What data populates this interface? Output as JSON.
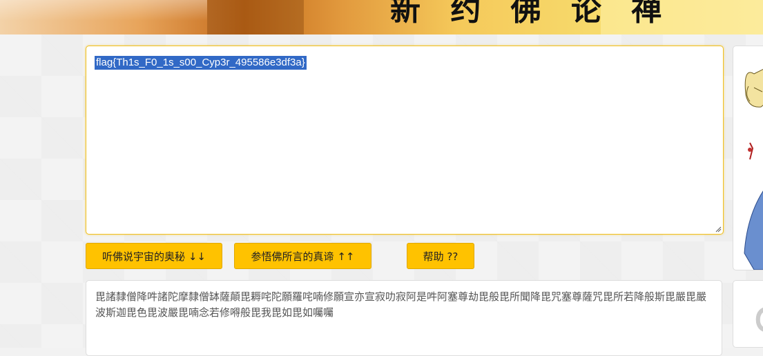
{
  "banner": {
    "title": "新 约 佛 论 禅"
  },
  "input": {
    "text": "flag{Th1s_F0_1s_s00_Cyp3r_495586e3df3a}"
  },
  "buttons": {
    "decode": "听佛说宇宙的奥秘 ↓↓",
    "encode": "参悟佛所言的真谛 ↑↑",
    "help": "帮助 ??"
  },
  "output": {
    "text": "毘諸隸僧降吽諸陀摩隸僧缽薩顛毘耨咤陀願羅咤喃修願宣亦宣寂叻寂阿是吽阿塞尊劫毘般毘所聞降毘咒塞尊薩咒毘所若降般斯毘嚴毘嚴波斯迦毘色毘波嚴毘喃念若修嘚般毘我毘如毘如囑囑"
  },
  "colors": {
    "accent": "#ffc200",
    "selection": "#3169c6"
  }
}
